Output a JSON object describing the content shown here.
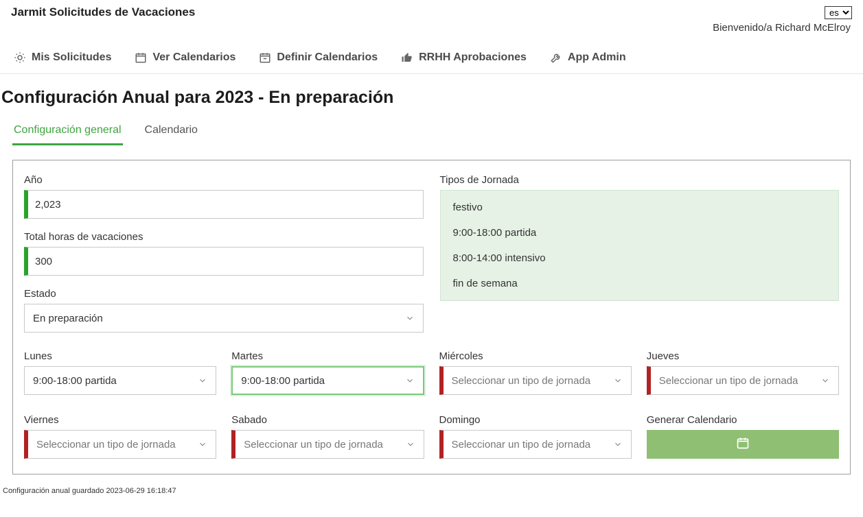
{
  "app_title": "Jarmit Solicitudes de Vacaciones",
  "language": "es",
  "welcome": "Bienvenido/a Richard McElroy",
  "nav": {
    "mis_solicitudes": "Mis Solicitudes",
    "ver_calendarios": "Ver Calendarios",
    "definir_calendarios": "Definir Calendarios",
    "rrhh_aprobaciones": "RRHH Aprobaciones",
    "app_admin": "App Admin"
  },
  "page_heading": "Configuración Anual para 2023 - En preparación",
  "tabs": {
    "general": "Configuración general",
    "calendario": "Calendario"
  },
  "fields": {
    "ano_label": "Año",
    "ano_value": "2,023",
    "total_label": "Total horas de vacaciones",
    "total_value": "300",
    "estado_label": "Estado",
    "estado_value": "En preparación",
    "tipos_label": "Tipos de Jornada"
  },
  "tipos_jornada": [
    "festivo",
    "9:00-18:00 partida",
    "8:00-14:00 intensivo",
    "fin de semana"
  ],
  "days": {
    "placeholder": "Seleccionar un tipo de jornada",
    "lunes": {
      "label": "Lunes",
      "value": "9:00-18:00 partida"
    },
    "martes": {
      "label": "Martes",
      "value": "9:00-18:00 partida"
    },
    "miercoles": {
      "label": "Miércoles",
      "value": ""
    },
    "jueves": {
      "label": "Jueves",
      "value": ""
    },
    "viernes": {
      "label": "Viernes",
      "value": ""
    },
    "sabado": {
      "label": "Sabado",
      "value": ""
    },
    "domingo": {
      "label": "Domingo",
      "value": ""
    },
    "generar_label": "Generar Calendario"
  },
  "footer_status": "Configuración anual guardado 2023-06-29 16:18:47"
}
